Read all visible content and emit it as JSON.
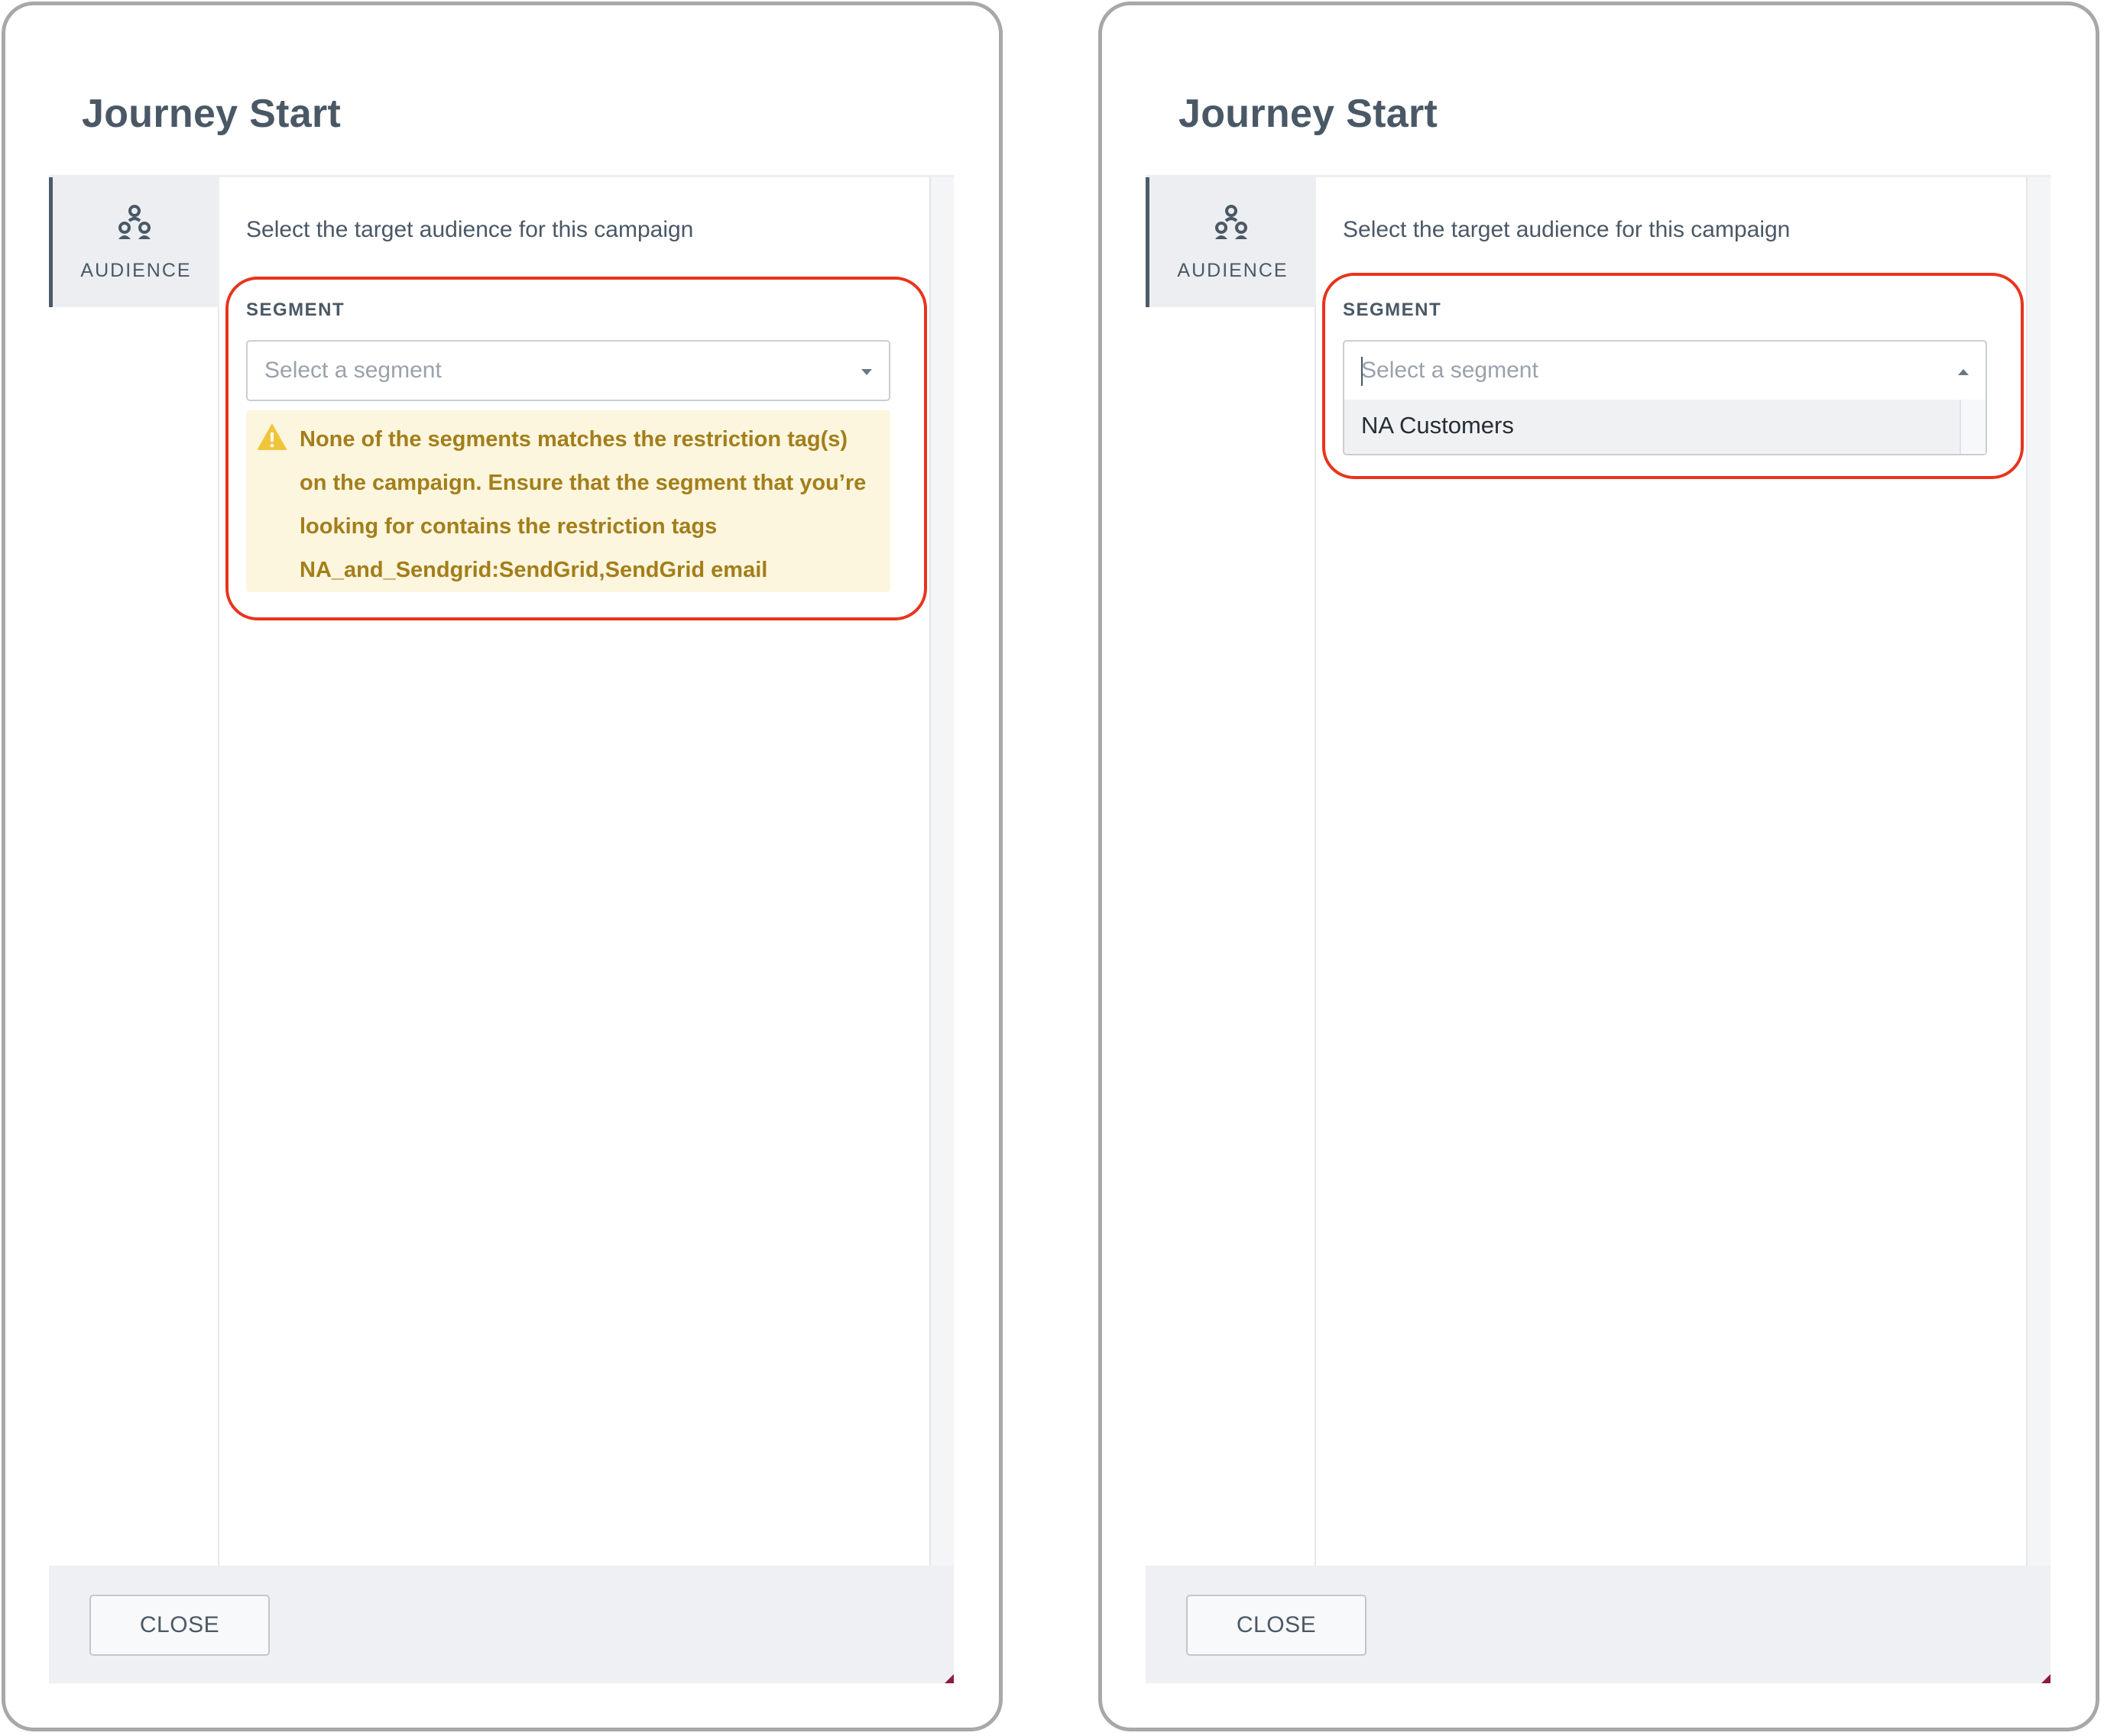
{
  "left_panel": {
    "title": "Journey Start",
    "tab_label": "AUDIENCE",
    "tab_icon": "audience-icon",
    "intro": "Select the target audience for this campaign",
    "segment_label": "SEGMENT",
    "select_placeholder": "Select a segment",
    "select_value": "",
    "warning_icon": "warning-icon",
    "warning_text": "None of the segments matches the restriction tag(s) on the campaign. Ensure that the segment that you’re looking for contains the restriction tags NA_and_Sendgrid:SendGrid,SendGrid email",
    "close_label": "CLOSE"
  },
  "right_panel": {
    "title": "Journey Start",
    "tab_label": "AUDIENCE",
    "tab_icon": "audience-icon",
    "intro": "Select the target audience for this campaign",
    "segment_label": "SEGMENT",
    "select_placeholder": "Select a segment",
    "select_value": "",
    "dropdown_options": [
      "NA Customers"
    ],
    "close_label": "CLOSE"
  },
  "colors": {
    "text": "#4a5866",
    "highlight": "#e8341c",
    "warning_bg": "#fcf6df",
    "warning_text": "#a37e1a",
    "warning_icon": "#f0c53d"
  }
}
